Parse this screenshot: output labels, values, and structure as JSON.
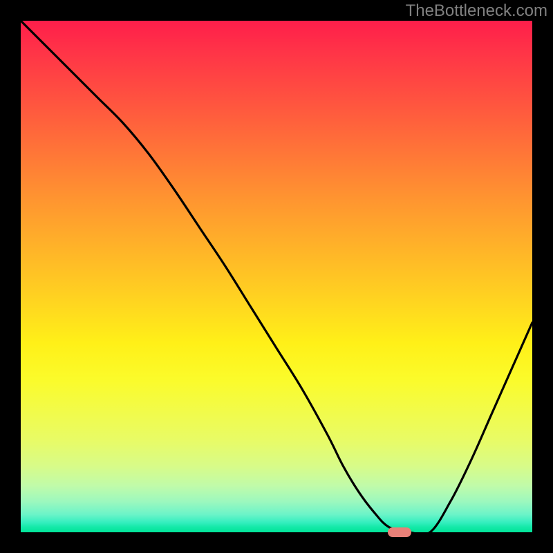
{
  "watermark": "TheBottleneck.com",
  "chart_data": {
    "type": "line",
    "title": "",
    "xlabel": "",
    "ylabel": "",
    "xlim": [
      0,
      100
    ],
    "ylim": [
      0,
      100
    ],
    "grid": false,
    "legend": false,
    "background": "heat-gradient",
    "series": [
      {
        "name": "bottleneck-curve",
        "color": "#000000",
        "x": [
          0,
          5,
          10,
          15,
          20,
          25,
          30,
          35,
          40,
          45,
          50,
          55,
          60,
          63,
          66,
          69,
          72,
          76,
          80,
          84,
          88,
          92,
          96,
          100
        ],
        "y": [
          100,
          95,
          90,
          85,
          80,
          74,
          67,
          59.5,
          52,
          44,
          36,
          28,
          19,
          13,
          8,
          4,
          1,
          0,
          0,
          6,
          14,
          23,
          32,
          41
        ]
      }
    ],
    "marker": {
      "x": 74,
      "y": 0,
      "color": "#e88078"
    },
    "gradient_stops": [
      {
        "pct": 0,
        "color": "#ff1e4a"
      },
      {
        "pct": 25,
        "color": "#ff7338"
      },
      {
        "pct": 50,
        "color": "#ffc524"
      },
      {
        "pct": 70,
        "color": "#fbfb2a"
      },
      {
        "pct": 90,
        "color": "#c0fbaa"
      },
      {
        "pct": 100,
        "color": "#00e498"
      }
    ]
  }
}
